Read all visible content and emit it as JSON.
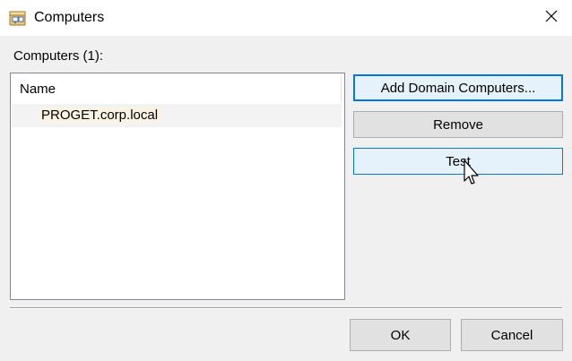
{
  "window": {
    "title": "Computers",
    "title_icon": "computers-app-icon",
    "close_icon": "close-icon"
  },
  "list": {
    "label": "Computers (1):",
    "column_header": "Name",
    "items": [
      {
        "name": "PROGET.corp.local"
      }
    ]
  },
  "buttons": {
    "add_domain_computers": "Add Domain Computers...",
    "remove": "Remove",
    "test": "Test",
    "ok": "OK",
    "cancel": "Cancel"
  },
  "colors": {
    "accent": "#0078d7",
    "button_face": "#e1e1e1",
    "hover_face": "#e5f1fb",
    "dialog_bg": "#f0f0f0"
  }
}
